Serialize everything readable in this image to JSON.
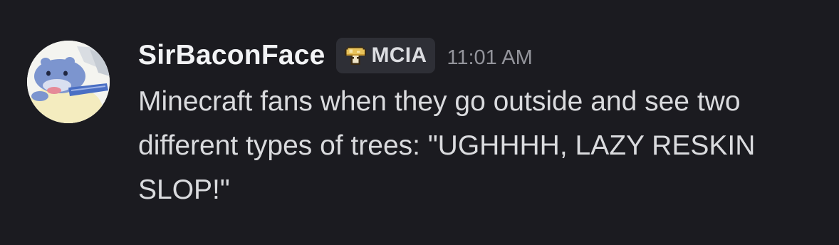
{
  "message": {
    "username": "SirBaconFace",
    "tag": {
      "icon": "mushroom-icon",
      "label": "MCIA"
    },
    "timestamp": "11:01 AM",
    "text": "Minecraft fans when they go outside and see two different types of trees: \"UGHHHH, LAZY RESKIN SLOP!\"",
    "avatar": "spheal-avatar"
  },
  "colors": {
    "background": "#1b1b20",
    "username": "#f2f3f5",
    "tag_background": "#2e2f36",
    "timestamp": "#93949b",
    "body_text": "#dadbde"
  }
}
